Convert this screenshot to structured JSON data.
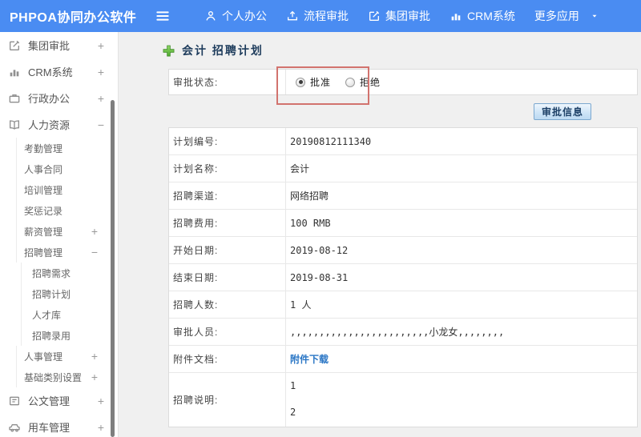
{
  "app": {
    "logo": "PHPOA协同办公软件"
  },
  "header": {
    "nav": [
      {
        "label": "个人办公",
        "icon": "person-icon"
      },
      {
        "label": "流程审批",
        "icon": "submit-icon"
      },
      {
        "label": "集团审批",
        "icon": "compose-icon"
      },
      {
        "label": "CRM系统",
        "icon": "bar-chart-icon"
      },
      {
        "label": "更多应用",
        "trailing_icon": "caret-down-icon"
      }
    ]
  },
  "sidebar": {
    "items": [
      {
        "label": "集团审批",
        "level": 0,
        "icon": "compose-icon",
        "expand": "+"
      },
      {
        "label": "CRM系统",
        "level": 0,
        "icon": "bar-chart-icon",
        "expand": "+"
      },
      {
        "label": "行政办公",
        "level": 0,
        "icon": "briefcase-icon",
        "expand": "+"
      },
      {
        "label": "人力资源",
        "level": 0,
        "icon": "book-icon",
        "expand": "−"
      },
      {
        "label": "考勤管理",
        "level": 1
      },
      {
        "label": "人事合同",
        "level": 1
      },
      {
        "label": "培训管理",
        "level": 1
      },
      {
        "label": "奖惩记录",
        "level": 1
      },
      {
        "label": "薪资管理",
        "level": 1,
        "expand": "+"
      },
      {
        "label": "招聘管理",
        "level": 1,
        "expand": "−"
      },
      {
        "label": "招聘需求",
        "level": 2
      },
      {
        "label": "招聘计划",
        "level": 2
      },
      {
        "label": "人才库",
        "level": 2
      },
      {
        "label": "招聘录用",
        "level": 2
      },
      {
        "label": "人事管理",
        "level": 1,
        "expand": "+"
      },
      {
        "label": "基础类别设置",
        "level": 1,
        "expand": "+"
      },
      {
        "label": "公文管理",
        "level": 0,
        "icon": "document-icon",
        "expand": "+"
      },
      {
        "label": "用车管理",
        "level": 0,
        "icon": "car-icon",
        "expand": "+"
      }
    ]
  },
  "main": {
    "title": "会计 招聘计划",
    "approval_status": {
      "label": "审批状态:",
      "options": [
        {
          "label": "批准",
          "checked": true
        },
        {
          "label": "拒绝",
          "checked": false
        }
      ]
    },
    "approval_info_button": "审批信息",
    "fields": [
      {
        "label": "计划编号:",
        "value": "20190812111340"
      },
      {
        "label": "计划名称:",
        "value": "会计"
      },
      {
        "label": "招聘渠道:",
        "value": "网络招聘"
      },
      {
        "label": "招聘费用:",
        "value": "100 RMB"
      },
      {
        "label": "开始日期:",
        "value": "2019-08-12"
      },
      {
        "label": "结束日期:",
        "value": "2019-08-31"
      },
      {
        "label": "招聘人数:",
        "value": "1 人"
      },
      {
        "label": "审批人员:",
        "value": ",,,,,,,,,,,,,,,,,,,,,,,,小龙女,,,,,,,,"
      },
      {
        "label": "附件文档:",
        "value": "附件下载",
        "type": "link"
      },
      {
        "label": "招聘说明:",
        "value": [
          "1",
          "2"
        ],
        "type": "multiline"
      }
    ]
  },
  "colors": {
    "header_blue": "#4a8cf2",
    "link_blue": "#2a76c5",
    "annotation_red": "#d2736e",
    "plus_green": "#5fb73e",
    "button_border_blue": "#7ca8cf"
  }
}
